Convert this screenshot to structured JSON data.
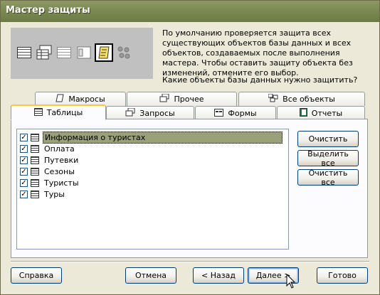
{
  "window": {
    "title": "Мастер защиты"
  },
  "intro": {
    "description": "По умолчанию проверяется защита всех существующих объектов базы данных и всех объектов, создаваемых после выполнения мастера. Чтобы оставить защиту объекта без изменений, отмените его выбор.",
    "question": "Какие объекты базы данных нужно защитить?",
    "preview_icons": [
      "table-icon",
      "query-icon",
      "form-icon",
      "report-icon",
      "macro-icon",
      "modules-icon"
    ]
  },
  "tabs_back": [
    {
      "label": "Макросы",
      "icon": "macro-icon"
    },
    {
      "label": "Прочее",
      "icon": "other-icon"
    },
    {
      "label": "Все объекты",
      "icon": "all-objects-icon"
    }
  ],
  "tabs_front": [
    {
      "label": "Таблицы",
      "icon": "table-icon",
      "active": true
    },
    {
      "label": "Запросы",
      "icon": "query-icon"
    },
    {
      "label": "Формы",
      "icon": "form-icon"
    },
    {
      "label": "Отчеты",
      "icon": "report-icon"
    }
  ],
  "list": {
    "items": [
      {
        "label": "Информация о туристах",
        "checked": true,
        "selected": true
      },
      {
        "label": "Оплата",
        "checked": true
      },
      {
        "label": "Путевки",
        "checked": true
      },
      {
        "label": "Сезоны",
        "checked": true
      },
      {
        "label": "Туристы",
        "checked": true
      },
      {
        "label": "Туры",
        "checked": true
      }
    ]
  },
  "side_buttons": {
    "clear": "Очистить",
    "select_all": "Выделить все",
    "clear_all": "Очистить все"
  },
  "footer_buttons": {
    "help": "Справка",
    "cancel": "Отмена",
    "back": "< Назад",
    "next": "Далее >",
    "finish": "Готово"
  },
  "colors": {
    "titlebar": "#7b8a52",
    "selection": "#9aa07a",
    "dialog_bg": "#ece9d8",
    "tab_highlight": "#ffc83c"
  }
}
